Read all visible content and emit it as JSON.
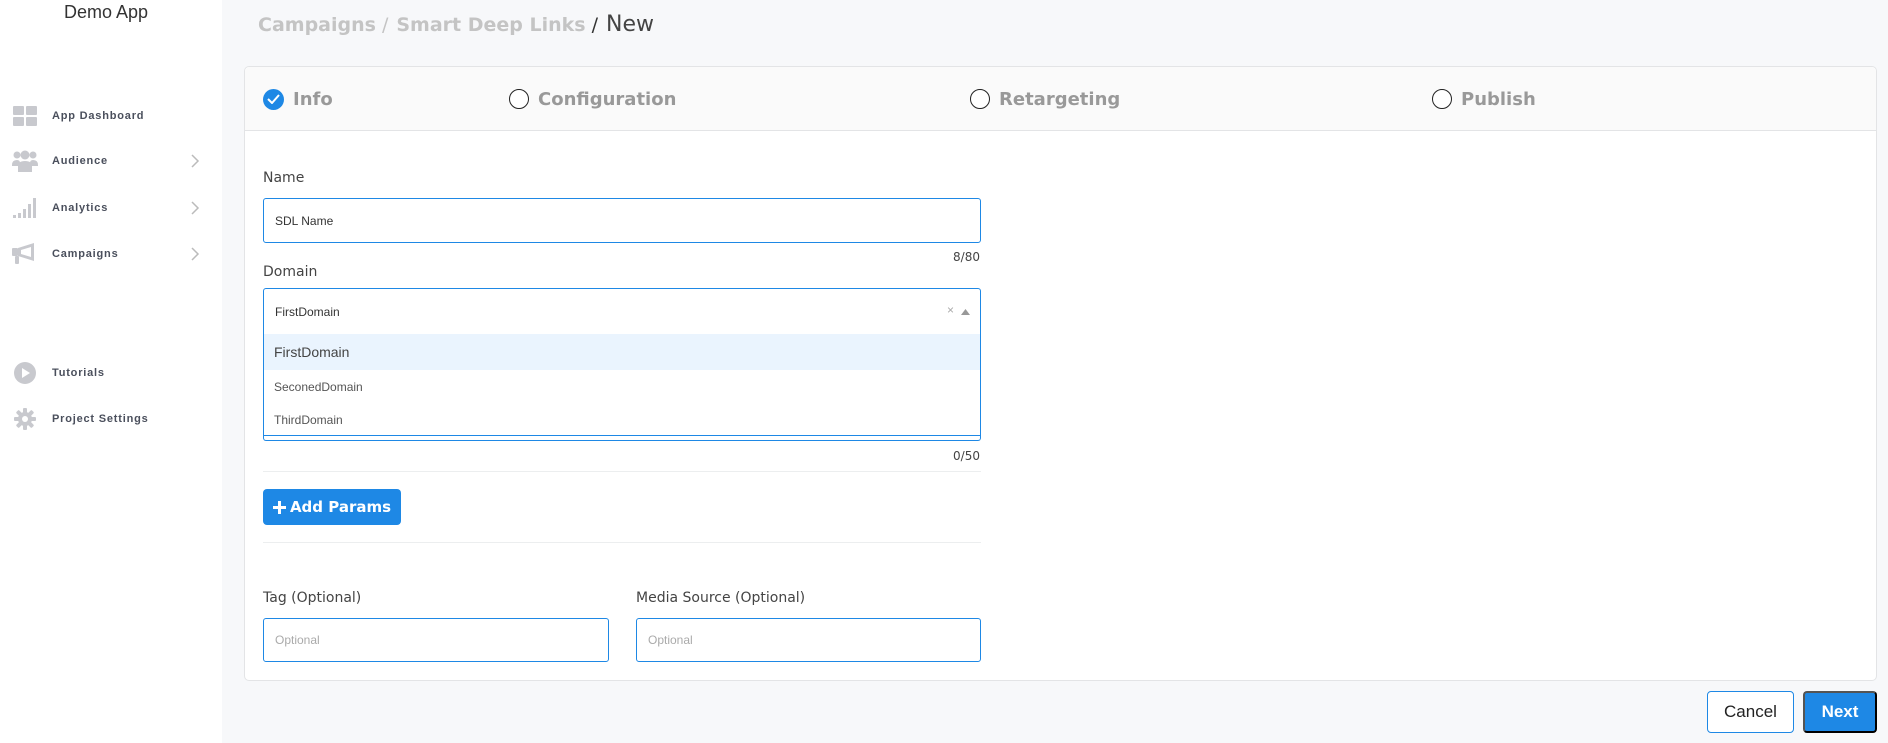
{
  "app": {
    "name": "Demo App"
  },
  "sidebar": {
    "items": [
      {
        "label": "App Dashboard",
        "icon": "dashboard-grid-icon",
        "has_submenu": false
      },
      {
        "label": "Audience",
        "icon": "users-group-icon",
        "has_submenu": true
      },
      {
        "label": "Analytics",
        "icon": "signal-bars-icon",
        "has_submenu": true
      },
      {
        "label": "Campaigns",
        "icon": "megaphone-icon",
        "has_submenu": true
      },
      {
        "label": "Tutorials",
        "icon": "play-circle-icon",
        "has_submenu": false
      },
      {
        "label": "Project Settings",
        "icon": "gear-icon",
        "has_submenu": false
      }
    ]
  },
  "breadcrumb": {
    "items": [
      "Campaigns",
      "Smart Deep Links"
    ],
    "separator": "/",
    "current": "New"
  },
  "steps": [
    {
      "label": "Info",
      "status": "completed"
    },
    {
      "label": "Configuration",
      "status": "pending"
    },
    {
      "label": "Retargeting",
      "status": "pending"
    },
    {
      "label": "Publish",
      "status": "pending"
    }
  ],
  "form": {
    "name": {
      "label": "Name",
      "value": "SDL Name",
      "counter": "8/80"
    },
    "domain": {
      "label": "Domain",
      "value": "FirstDomain",
      "clear_glyph": "×",
      "options": [
        "FirstDomain",
        "SeconedDomain",
        "ThirdDomain"
      ],
      "highlighted": "FirstDomain"
    },
    "hidden_field_counter": "0/50",
    "add_params_label": "Add Params",
    "tag": {
      "label": "Tag (Optional)",
      "placeholder": "Optional",
      "value": ""
    },
    "media_source": {
      "label": "Media Source (Optional)",
      "placeholder": "Optional",
      "value": ""
    }
  },
  "footer": {
    "cancel_label": "Cancel",
    "next_label": "Next"
  },
  "colors": {
    "accent": "#1e88e5",
    "sidebar_icon": "#c8c9ce",
    "muted_text": "#999999"
  }
}
